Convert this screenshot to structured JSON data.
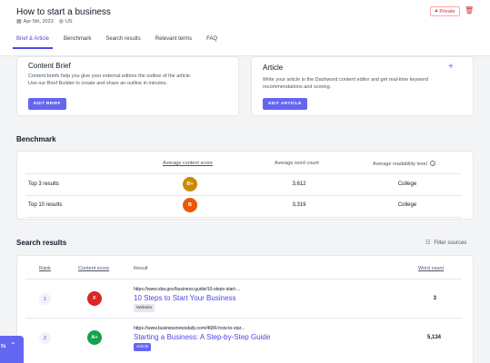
{
  "header": {
    "title": "How to start a business",
    "date": "Apr 5th, 2023",
    "locale": "US",
    "private_label": "Private",
    "icons": {
      "date": "calendar-icon",
      "locale": "globe-icon",
      "private": "lock-icon",
      "delete": "trash-icon"
    }
  },
  "tabs": [
    {
      "label": "Brief & Article",
      "active": true
    },
    {
      "label": "Benchmark",
      "active": false
    },
    {
      "label": "Search results",
      "active": false
    },
    {
      "label": "Relevant terms",
      "active": false
    },
    {
      "label": "FAQ",
      "active": false
    }
  ],
  "brief": {
    "title": "Content Brief",
    "desc_line1": "Content briefs help you give your external editors the outline of the article.",
    "desc_line2": "Use our Brief Builder to create and share an outline in minutes.",
    "button": "EDIT BRIEF"
  },
  "article": {
    "title": "Article",
    "desc_line1": "Write your article in the Dashword content editor and get real-time keyword",
    "desc_line2": "recommendations and scoring.",
    "button": "EDIT ARTICLE",
    "plus": "+"
  },
  "benchmark": {
    "title": "Benchmark",
    "headers": {
      "score": "Average content score",
      "words": "Average word count",
      "readability": "Average readability level"
    },
    "rows": [
      {
        "label": "Top 3 results",
        "grade": "B+",
        "grade_color": "#ca8a04",
        "words": "3,612",
        "readability": "College"
      },
      {
        "label": "Top 10 results",
        "grade": "B",
        "grade_color": "#ea580c",
        "words": "3,319",
        "readability": "College"
      }
    ]
  },
  "search_results": {
    "title": "Search results",
    "filter_label": "Filter sources",
    "headers": {
      "rank": "Rank",
      "score": "Content score",
      "result": "Result",
      "words": "Word count"
    },
    "rows": [
      {
        "rank": "1",
        "grade": "F",
        "grade_color": "#dc2626",
        "url": "https://www.sba.gov/business-guide/10-steps-start-...",
        "title": "10 Steps to Start Your Business",
        "tag": "Website",
        "words": "3"
      },
      {
        "rank": "2",
        "grade": "A+",
        "grade_color": "#16a34a",
        "url": "https://www.businessnewsdaily.com/4686-how-to-star...",
        "title": "Starting a Business: A Step-by-Step Guide",
        "tag": "Article",
        "words": "5,134"
      }
    ]
  },
  "float_button": {
    "label": "ts"
  }
}
